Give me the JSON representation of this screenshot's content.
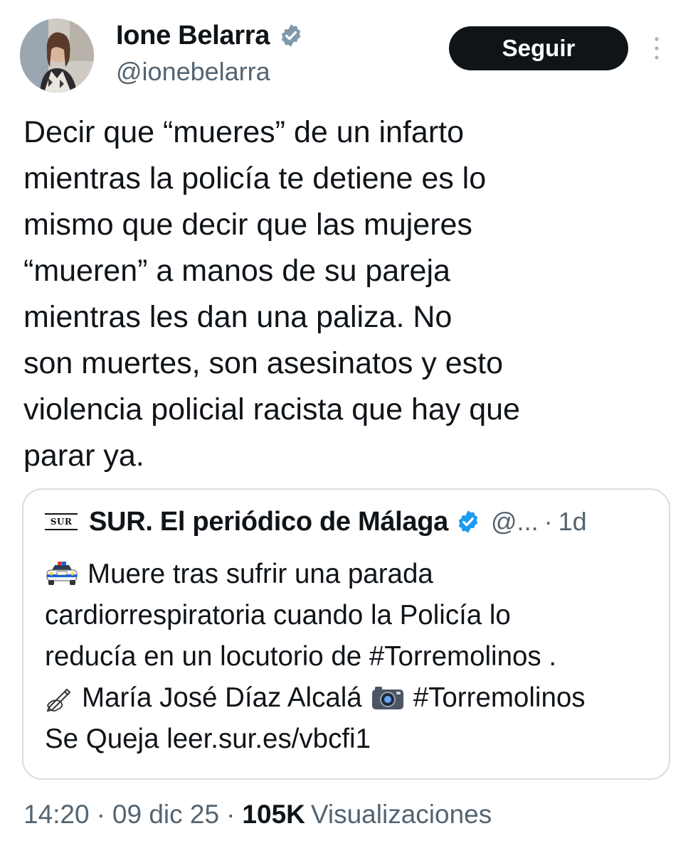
{
  "author": {
    "display_name": "Ione Belarra",
    "handle": "@ionebelarra",
    "verified": true,
    "avatar_icon": "profile-photo"
  },
  "actions": {
    "follow_label": "Seguir",
    "more_icon": "vertical-ellipsis-icon"
  },
  "tweet": {
    "lines": [
      "Decir que “mueres” de un infarto",
      "mientras la policía te detiene es lo",
      "mismo que decir que las mujeres",
      "“mueren” a manos de su pareja",
      "mientras les dan una paliza. No",
      "son muertes, son asesinatos y esto",
      "violencia policial racista que hay que",
      "parar ya."
    ]
  },
  "quote": {
    "logo_text": "SUR",
    "display_name": "SUR. El periódico de Málaga",
    "handle": "@...",
    "separator": "·",
    "time": "1d",
    "verified": true,
    "lines": [
      {
        "emoji": "police-car-icon",
        "text": "Muere tras sufrir una parada"
      },
      {
        "text": "cardiorrespiratoria cuando la Policía lo"
      },
      {
        "text": "reducía en un locutorio de #Torremolinos ."
      },
      {
        "emoji": "writing-hand-icon",
        "text": "María José Díaz Alcalá",
        "emoji2": "camera-icon",
        "text2": "#Torremolinos"
      },
      {
        "text": "Se Queja leer.sur.es/vbcfi1"
      }
    ]
  },
  "meta": {
    "time": "14:20",
    "separator": "·",
    "date": "09 dic 25",
    "views_count": "105K",
    "views_label": "Visualizaciones"
  },
  "colors": {
    "text": "#0f1419",
    "secondary_text": "#536471",
    "verified_blue": "#1d9bf0",
    "author_badge_gray": "#829aab",
    "border": "#d6dde2",
    "button_bg": "#0f1419"
  }
}
